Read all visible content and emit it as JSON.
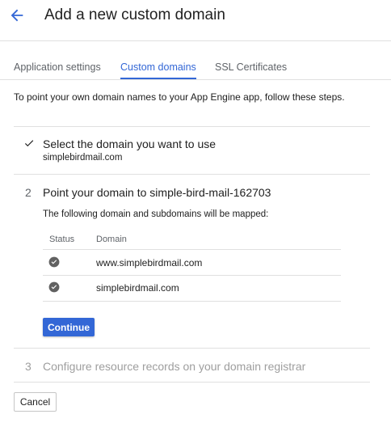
{
  "header": {
    "title": "Add a new custom domain",
    "back_icon": "arrow-back-icon"
  },
  "tabs": [
    {
      "label": "Application settings",
      "active": false
    },
    {
      "label": "Custom domains",
      "active": true
    },
    {
      "label": "SSL Certificates",
      "active": false
    }
  ],
  "intro": "To point your own domain names to your App Engine app, follow these steps.",
  "steps": [
    {
      "status": "complete",
      "icon": "check-icon",
      "title": "Select the domain you want to use",
      "subtitle": "simplebirdmail.com"
    },
    {
      "number": "2",
      "status": "active",
      "title": "Point your domain to simple-bird-mail-162703",
      "description": "The following domain and subdomains will be mapped:"
    },
    {
      "number": "3",
      "status": "disabled",
      "title": "Configure resource records on your domain registrar"
    }
  ],
  "mapping_table": {
    "headers": {
      "status": "Status",
      "domain": "Domain"
    },
    "rows": [
      {
        "status_icon": "check-circle-icon",
        "domain": "www.simplebirdmail.com"
      },
      {
        "status_icon": "check-circle-icon",
        "domain": "simplebirdmail.com"
      }
    ]
  },
  "buttons": {
    "continue": "Continue",
    "cancel": "Cancel"
  },
  "colors": {
    "accent": "#3367d6",
    "divider": "#e0e0e0",
    "check": "#616161",
    "muted": "#9e9e9e"
  }
}
